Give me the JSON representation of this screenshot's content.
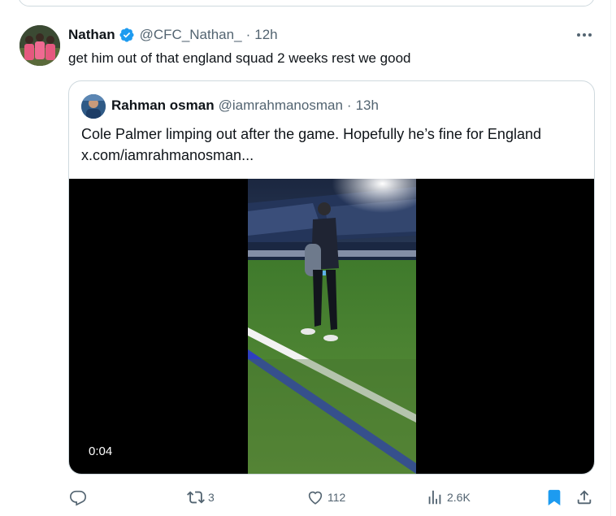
{
  "tweet": {
    "author_name": "Nathan",
    "author_handle": "@CFC_Nathan_",
    "separator": "·",
    "time": "12h",
    "text": "get him out of that england squad 2 weeks rest we good"
  },
  "quote": {
    "author_name": "Rahman osman",
    "author_handle": "@iamrahmanosman",
    "separator": "·",
    "time": "13h",
    "text_line1": "Cole Palmer limping out after the game. Hopefully he’s fine for England",
    "text_line2": "x.com/iamrahmanosman...",
    "video_duration": "0:04"
  },
  "actions": {
    "replies": "",
    "retweets": "3",
    "likes": "112",
    "views": "2.6K"
  },
  "icons": {
    "verified": "verified-badge-icon",
    "more": "more-dots-icon",
    "reply": "reply-icon",
    "retweet": "retweet-icon",
    "like": "heart-icon",
    "views": "views-chart-icon",
    "bookmark": "bookmark-icon",
    "share": "share-icon"
  },
  "colors": {
    "accent": "#1d9bf0",
    "text_primary": "#0f1419",
    "text_secondary": "#536471",
    "border": "#cfd9de",
    "verified": "#1d9bf0"
  }
}
